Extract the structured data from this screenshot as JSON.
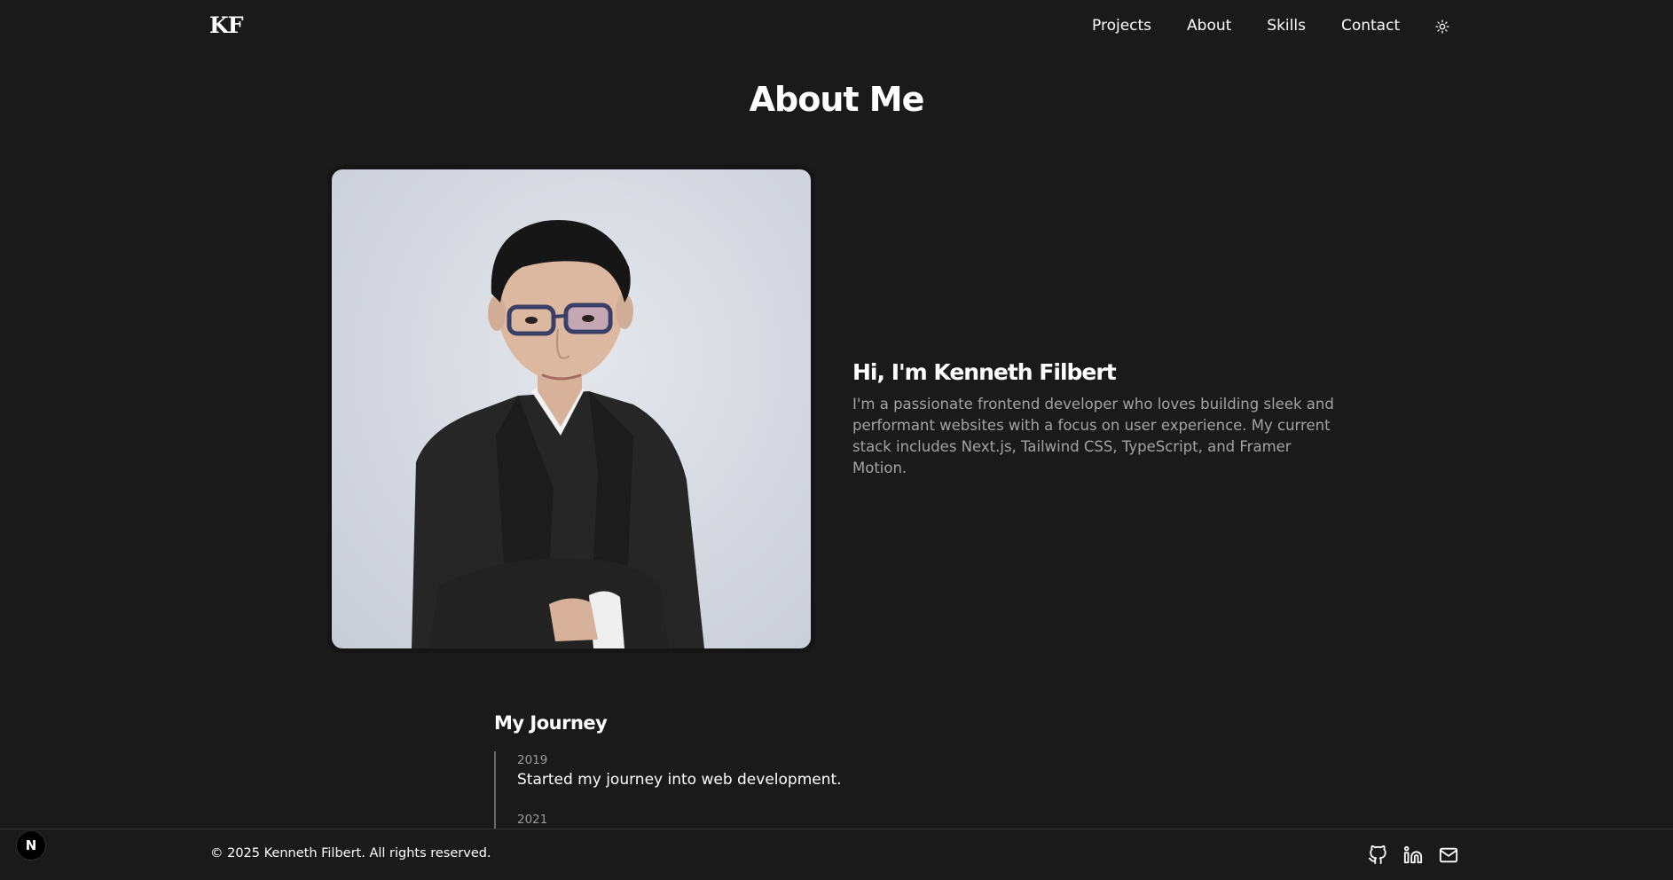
{
  "header": {
    "logo": "KF",
    "nav": [
      {
        "label": "Projects"
      },
      {
        "label": "About"
      },
      {
        "label": "Skills"
      },
      {
        "label": "Contact"
      }
    ],
    "theme_icon": "sun-icon"
  },
  "about": {
    "title": "About Me",
    "photo_icon": "profile-photo",
    "heading": "Hi, I'm Kenneth Filbert",
    "bio": "I'm a passionate frontend developer who loves building sleek and performant websites with a focus on user experience. My current stack includes Next.js, Tailwind CSS, TypeScript, and Framer Motion."
  },
  "journey": {
    "title": "My Journey",
    "items": [
      {
        "year": "2019",
        "text": "Started my journey into web development."
      },
      {
        "year": "2021",
        "text": ""
      }
    ]
  },
  "footer": {
    "copyright": "© 2025 Kenneth Filbert. All rights reserved.",
    "social_icons": [
      "github-icon",
      "linkedin-icon",
      "mail-icon"
    ]
  },
  "dev_badge": {
    "label": "N"
  },
  "colors": {
    "background": "#1a1a1a",
    "text": "#ffffff",
    "muted_text": "#a3a3a3",
    "border": "#333333"
  }
}
